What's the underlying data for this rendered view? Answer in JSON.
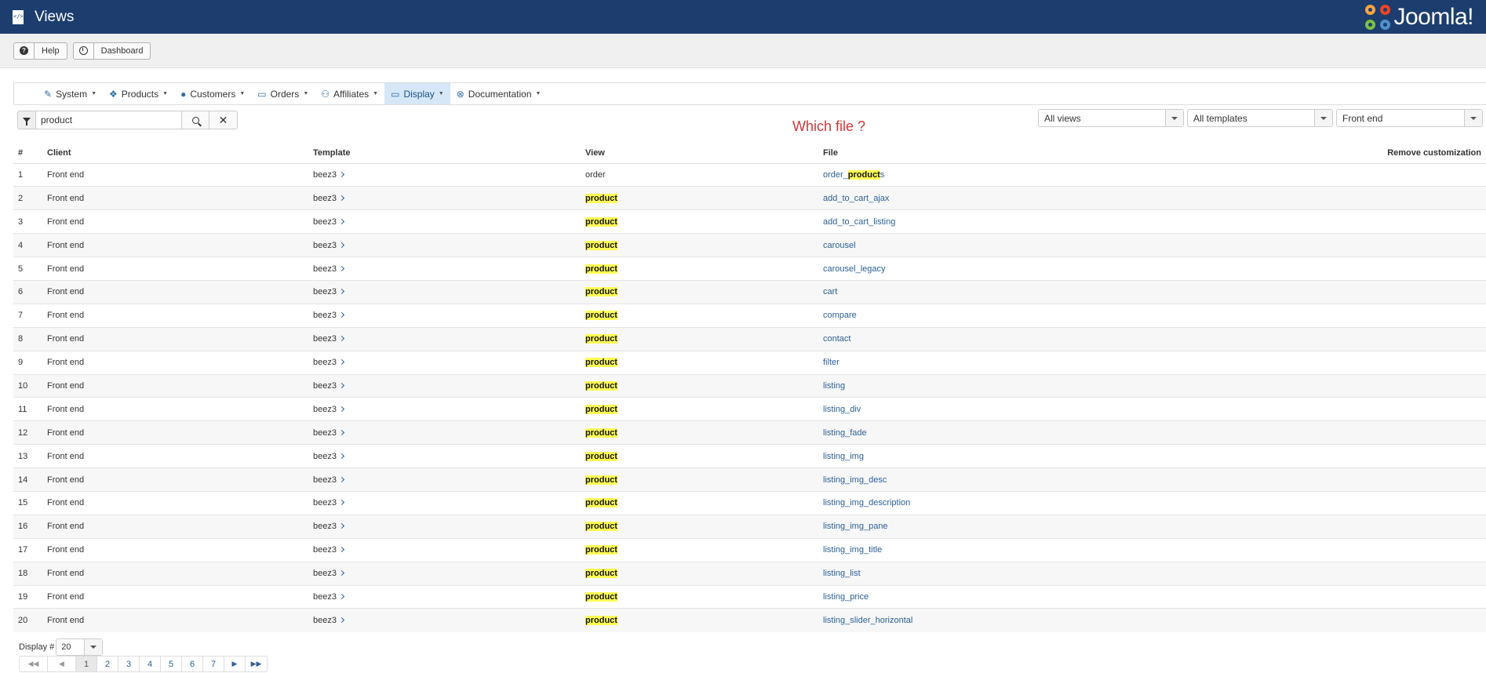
{
  "header": {
    "title": "Views",
    "brand": "Joomla!"
  },
  "toolbar": {
    "help_label": "Help",
    "dashboard_label": "Dashboard"
  },
  "menu": {
    "items": [
      {
        "label": "System",
        "icon": "wrench-icon"
      },
      {
        "label": "Products",
        "icon": "cubes-icon"
      },
      {
        "label": "Customers",
        "icon": "user-icon"
      },
      {
        "label": "Orders",
        "icon": "credit-card-icon"
      },
      {
        "label": "Affiliates",
        "icon": "users-icon"
      },
      {
        "label": "Display",
        "icon": "desktop-icon",
        "active": true
      },
      {
        "label": "Documentation",
        "icon": "life-ring-icon"
      }
    ]
  },
  "filter": {
    "search_value": "product"
  },
  "annotation": "Which file ?",
  "selects": {
    "views": "All views",
    "templates": "All templates",
    "client": "Front end"
  },
  "table": {
    "headers": {
      "num": "#",
      "client": "Client",
      "template": "Template",
      "view": "View",
      "file": "File",
      "remove": "Remove customization"
    },
    "rows": [
      {
        "n": "1",
        "client": "Front end",
        "template": "beez3",
        "view": "order",
        "file_pre": "order_",
        "file_hl": "product",
        "file_post": "s"
      },
      {
        "n": "2",
        "client": "Front end",
        "template": "beez3",
        "view": "product",
        "file": "add_to_cart_ajax"
      },
      {
        "n": "3",
        "client": "Front end",
        "template": "beez3",
        "view": "product",
        "file": "add_to_cart_listing"
      },
      {
        "n": "4",
        "client": "Front end",
        "template": "beez3",
        "view": "product",
        "file": "carousel"
      },
      {
        "n": "5",
        "client": "Front end",
        "template": "beez3",
        "view": "product",
        "file": "carousel_legacy"
      },
      {
        "n": "6",
        "client": "Front end",
        "template": "beez3",
        "view": "product",
        "file": "cart"
      },
      {
        "n": "7",
        "client": "Front end",
        "template": "beez3",
        "view": "product",
        "file": "compare"
      },
      {
        "n": "8",
        "client": "Front end",
        "template": "beez3",
        "view": "product",
        "file": "contact"
      },
      {
        "n": "9",
        "client": "Front end",
        "template": "beez3",
        "view": "product",
        "file": "filter"
      },
      {
        "n": "10",
        "client": "Front end",
        "template": "beez3",
        "view": "product",
        "file": "listing"
      },
      {
        "n": "11",
        "client": "Front end",
        "template": "beez3",
        "view": "product",
        "file": "listing_div"
      },
      {
        "n": "12",
        "client": "Front end",
        "template": "beez3",
        "view": "product",
        "file": "listing_fade"
      },
      {
        "n": "13",
        "client": "Front end",
        "template": "beez3",
        "view": "product",
        "file": "listing_img"
      },
      {
        "n": "14",
        "client": "Front end",
        "template": "beez3",
        "view": "product",
        "file": "listing_img_desc"
      },
      {
        "n": "15",
        "client": "Front end",
        "template": "beez3",
        "view": "product",
        "file": "listing_img_description"
      },
      {
        "n": "16",
        "client": "Front end",
        "template": "beez3",
        "view": "product",
        "file": "listing_img_pane"
      },
      {
        "n": "17",
        "client": "Front end",
        "template": "beez3",
        "view": "product",
        "file": "listing_img_title"
      },
      {
        "n": "18",
        "client": "Front end",
        "template": "beez3",
        "view": "product",
        "file": "listing_list"
      },
      {
        "n": "19",
        "client": "Front end",
        "template": "beez3",
        "view": "product",
        "file": "listing_price"
      },
      {
        "n": "20",
        "client": "Front end",
        "template": "beez3",
        "view": "product",
        "file": "listing_slider_horizontal"
      }
    ]
  },
  "display": {
    "label": "Display #",
    "value": "20"
  },
  "pagination": {
    "pages": [
      "1",
      "2",
      "3",
      "4",
      "5",
      "6",
      "7"
    ],
    "current": "1"
  },
  "colors": {
    "header_bg": "#1c3d6e",
    "link": "#2a5f98",
    "highlight": "#ffff55",
    "annotation": "#d03838"
  }
}
